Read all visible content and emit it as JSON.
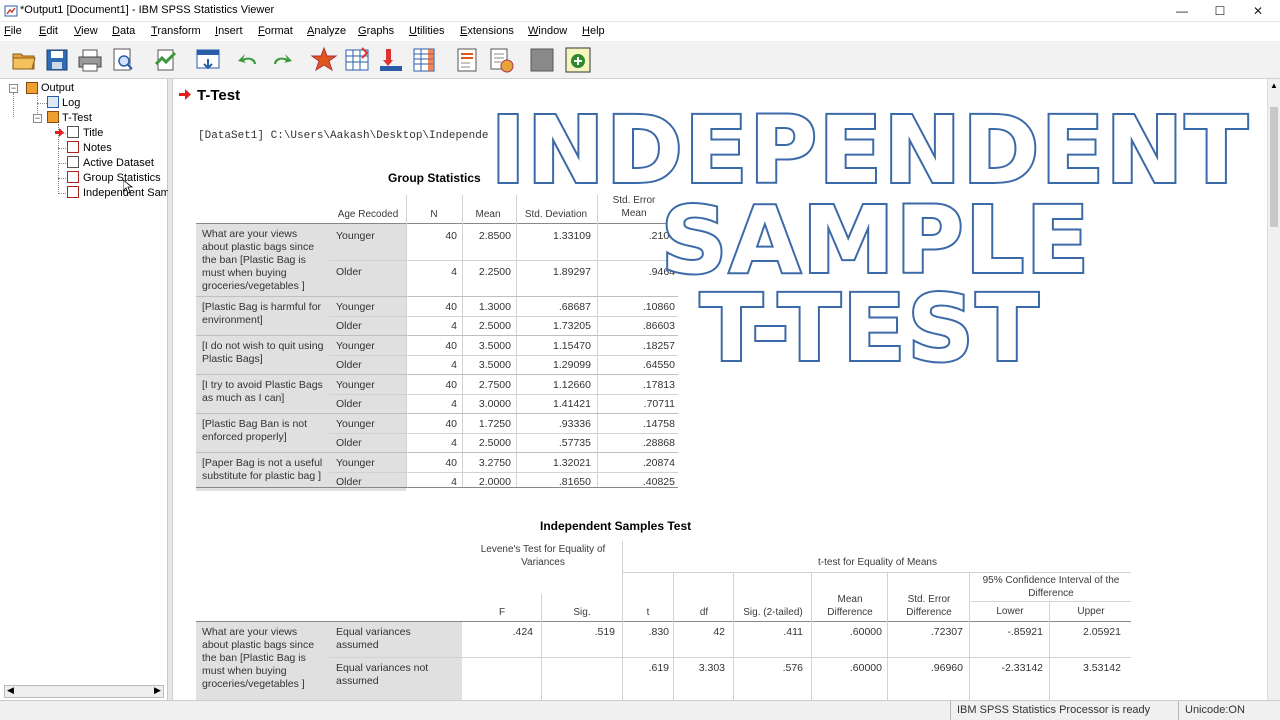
{
  "window": {
    "title": "*Output1 [Document1] - IBM SPSS Statistics Viewer",
    "controls": {
      "minimize": "—",
      "maximize": "☐",
      "close": "✕"
    }
  },
  "menu": [
    "File",
    "Edit",
    "View",
    "Data",
    "Transform",
    "Insert",
    "Format",
    "Analyze",
    "Graphs",
    "Utilities",
    "Extensions",
    "Window",
    "Help"
  ],
  "toolbar_icons": [
    "open-icon",
    "save-icon",
    "print-icon",
    "print-preview-icon",
    "export-icon",
    "recall-dialog-icon",
    "undo-icon",
    "redo-icon",
    "goto-data-icon",
    "goto-case-icon",
    "goto-variable-icon",
    "variables-icon",
    "create-title-icon",
    "create-text-icon",
    "show-all-icon",
    "designate-window-icon"
  ],
  "outline": {
    "items": [
      {
        "label": "Output"
      },
      {
        "label": "Log"
      },
      {
        "label": "T-Test"
      },
      {
        "label": "Title"
      },
      {
        "label": "Notes"
      },
      {
        "label": "Active Dataset"
      },
      {
        "label": "Group Statistics"
      },
      {
        "label": "Independent Sam"
      }
    ]
  },
  "content": {
    "heading": "T-Test",
    "dataset_line": "[DataSet1] C:\\Users\\Aakash\\Desktop\\Independe",
    "group_stats": {
      "title": "Group Statistics",
      "headers": {
        "group": "Age Recoded",
        "n": "N",
        "mean": "Mean",
        "sd": "Std. Deviation",
        "se_1": "Std. Error",
        "se_2": "Mean"
      },
      "variables": [
        {
          "label": "What are your views about plastic bags since the ban [Plastic Bag is must when buying groceries/vegetables ]",
          "rows": [
            {
              "g": "Younger",
              "n": "40",
              "m": "2.8500",
              "sd": "1.33109",
              "se": ".2104"
            },
            {
              "g": "Older",
              "n": "4",
              "m": "2.2500",
              "sd": "1.89297",
              "se": ".9464"
            }
          ]
        },
        {
          "label": "[Plastic Bag is harmful for environment]",
          "rows": [
            {
              "g": "Younger",
              "n": "40",
              "m": "1.3000",
              "sd": ".68687",
              "se": ".10860"
            },
            {
              "g": "Older",
              "n": "4",
              "m": "2.5000",
              "sd": "1.73205",
              "se": ".86603"
            }
          ]
        },
        {
          "label": "[I do not wish to quit using Plastic Bags]",
          "rows": [
            {
              "g": "Younger",
              "n": "40",
              "m": "3.5000",
              "sd": "1.15470",
              "se": ".18257"
            },
            {
              "g": "Older",
              "n": "4",
              "m": "3.5000",
              "sd": "1.29099",
              "se": ".64550"
            }
          ]
        },
        {
          "label": "[I try to avoid Plastic Bags as much as I can]",
          "rows": [
            {
              "g": "Younger",
              "n": "40",
              "m": "2.7500",
              "sd": "1.12660",
              "se": ".17813"
            },
            {
              "g": "Older",
              "n": "4",
              "m": "3.0000",
              "sd": "1.41421",
              "se": ".70711"
            }
          ]
        },
        {
          "label": "[Plastic Bag Ban is not enforced properly]",
          "rows": [
            {
              "g": "Younger",
              "n": "40",
              "m": "1.7250",
              "sd": ".93336",
              "se": ".14758"
            },
            {
              "g": "Older",
              "n": "4",
              "m": "2.5000",
              "sd": ".57735",
              "se": ".28868"
            }
          ]
        },
        {
          "label": "[Paper Bag is not a useful substitute for plastic bag ]",
          "rows": [
            {
              "g": "Younger",
              "n": "40",
              "m": "3.2750",
              "sd": "1.32021",
              "se": ".20874"
            },
            {
              "g": "Older",
              "n": "4",
              "m": "2.0000",
              "sd": ".81650",
              "se": ".40825"
            }
          ]
        }
      ]
    },
    "ind_test": {
      "title": "Independent Samples Test",
      "levene_1": "Levene's Test for Equality of",
      "levene_2": "Variances",
      "ttest_hdr": "t-test for Equality of Means",
      "ci_1": "95% Confidence Interval of the",
      "ci_2": "Difference",
      "cols": {
        "F": "F",
        "sig": "Sig.",
        "t": "t",
        "df": "df",
        "sig2": "Sig. (2-tailed)",
        "md_1": "Mean",
        "md_2": "Difference",
        "se_1": "Std. Error",
        "se_2": "Difference",
        "lower": "Lower",
        "upper": "Upper"
      },
      "var_label": "What are your views about plastic bags since the ban [Plastic Bag is must when buying groceries/vegetables ]",
      "rows": [
        {
          "label": "Equal variances assumed",
          "F": ".424",
          "sig": ".519",
          "t": ".830",
          "df": "42",
          "sig2": ".411",
          "md": ".60000",
          "se": ".72307",
          "lower": "-.85921",
          "upper": "2.05921"
        },
        {
          "label": "Equal variances not assumed",
          "F": "",
          "sig": "",
          "t": ".619",
          "df": "3.303",
          "sig2": ".576",
          "md": ".60000",
          "se": ".96960",
          "lower": "-2.33142",
          "upper": "3.53142"
        }
      ]
    }
  },
  "overlay": {
    "line1": "INDEPENDENT",
    "line2": "SAMPLE",
    "line3": "T-TEST"
  },
  "status": {
    "processor": "IBM SPSS Statistics Processor is ready",
    "unicode": "Unicode:ON"
  },
  "colors": {
    "overlay_stroke": "#3c6aa8",
    "arrow": "#e02020",
    "grey_cell": "#e0e0e0"
  }
}
